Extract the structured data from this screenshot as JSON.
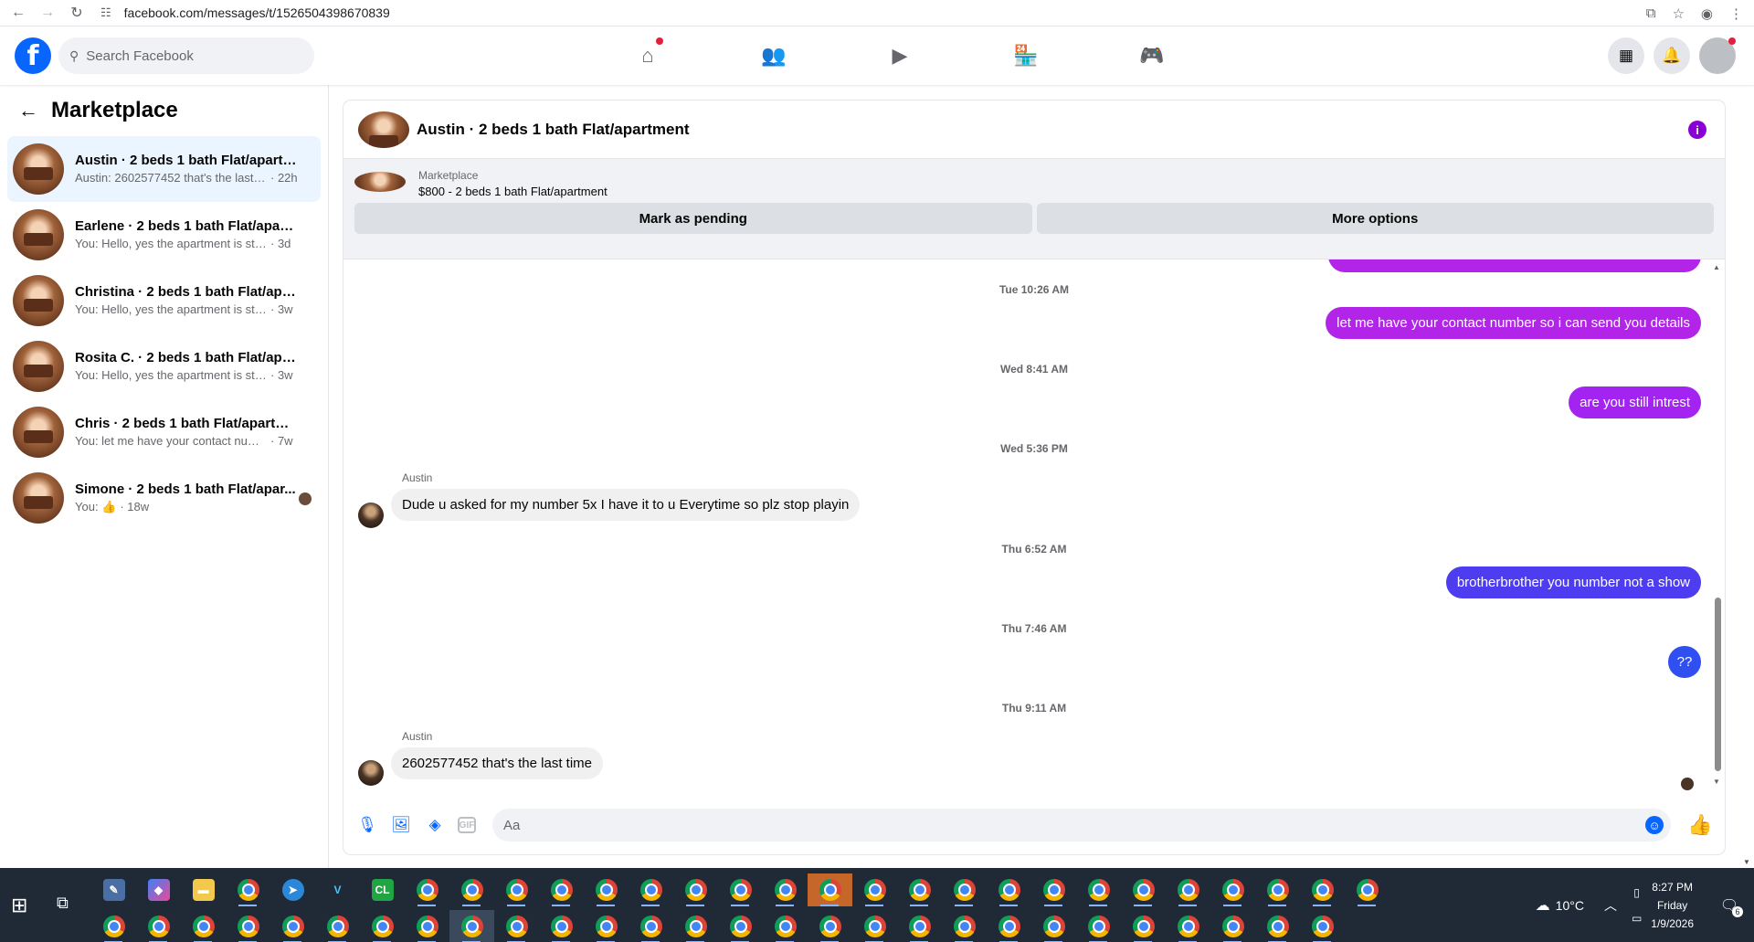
{
  "browser": {
    "url": "facebook.com/messages/t/1526504398670839",
    "icons": [
      "back-arrow-icon",
      "forward-arrow-icon",
      "reload-icon",
      "tune-icon",
      "install-app-icon",
      "star-icon",
      "profile-icon"
    ]
  },
  "header": {
    "logo": "f",
    "search_placeholder": "Search Facebook",
    "nav_icons": [
      "home-icon",
      "friends-icon",
      "video-icon",
      "marketplace-icon",
      "gaming-icon"
    ],
    "notification_color": "#e41e3f",
    "brand_color": "#0866ff"
  },
  "sidebar": {
    "title": "Marketplace",
    "conversations": [
      {
        "title": "Austin · 2 beds 1 bath Flat/apartm...",
        "snippet": "Austin: 2602577452 that's the last ti...",
        "time": "· 22h",
        "active": true
      },
      {
        "title": "Earlene · 2 beds 1 bath Flat/apart...",
        "snippet": "You: Hello, yes the apartment is still a...",
        "time": "· 3d"
      },
      {
        "title": "Christina · 2 beds 1 bath Flat/apart...",
        "snippet": "You: Hello, yes the apartment is still a...",
        "time": "· 3w"
      },
      {
        "title": "Rosita C. · 2 beds 1 bath Flat/apart...",
        "snippet": "You: Hello, yes the apartment is still a...",
        "time": "· 3w"
      },
      {
        "title": "Chris · 2 beds 1 bath Flat/apartment",
        "snippet": "You: let me have your contact numbe...",
        "time": "· 7w"
      },
      {
        "title": "Simone · 2 beds 1 bath Flat/apar...",
        "snippet": "You: 👍",
        "time": "· 18w"
      }
    ]
  },
  "chat": {
    "title": "Austin · 2 beds 1 bath Flat/apartment",
    "marketplace_label": "Marketplace",
    "listing": "$800 - 2 beds 1 bath Flat/apartment",
    "mark_pending": "Mark as pending",
    "more_options": "More options",
    "outgoing_color_purple": "#a033ff",
    "outgoing_color_blue": "#3b3fef",
    "messages": [
      {
        "type": "timestamp",
        "text": "Tue 10:26 AM"
      },
      {
        "type": "out",
        "text": "let me have your contact number so i can send you details",
        "color": "#b124e8"
      },
      {
        "type": "timestamp",
        "text": "Wed 8:41 AM"
      },
      {
        "type": "out",
        "text": "are you still intrest",
        "color": "#a324f0"
      },
      {
        "type": "timestamp",
        "text": "Wed 5:36 PM"
      },
      {
        "type": "in",
        "sender": "Austin",
        "text": "Dude u asked for my number 5x I have it to u Everytime so plz stop playin"
      },
      {
        "type": "timestamp",
        "text": "Thu 6:52 AM"
      },
      {
        "type": "out",
        "text": "brotherbrother you number not a show",
        "color": "#4d3cf0"
      },
      {
        "type": "timestamp",
        "text": "Thu 7:46 AM"
      },
      {
        "type": "out",
        "text": "??",
        "color": "#2f4ff0"
      },
      {
        "type": "timestamp",
        "text": "Thu 9:11 AM"
      },
      {
        "type": "in",
        "sender": "Austin",
        "text": "2602577452 that's the last time"
      }
    ],
    "composer_placeholder": "Aa"
  },
  "taskbar": {
    "weather": "10°C",
    "time": "8:27 PM",
    "day": "Friday",
    "date": "1/9/2026",
    "notification_count": "6"
  }
}
